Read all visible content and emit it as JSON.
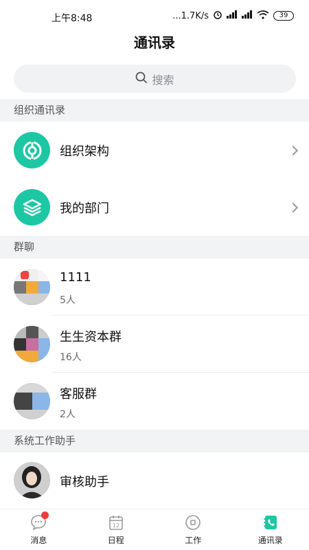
{
  "status_bar": {
    "time": "上午8:48",
    "network_speed": "...1.7K/s",
    "battery": "39"
  },
  "header": {
    "title": "通讯录"
  },
  "search": {
    "placeholder": "搜索"
  },
  "sections": {
    "org": {
      "header": "组织通讯录",
      "items": [
        {
          "label": "组织架构",
          "icon": "org-structure-icon"
        },
        {
          "label": "我的部门",
          "icon": "layers-icon"
        }
      ]
    },
    "groups": {
      "header": "群聊",
      "items": [
        {
          "name": "1111",
          "members": "5人"
        },
        {
          "name": "生生资本群",
          "members": "16人"
        },
        {
          "name": "客服群",
          "members": "2人"
        }
      ]
    },
    "assistants": {
      "header": "系统工作助手",
      "items": [
        {
          "name": "审核助手"
        }
      ]
    }
  },
  "tab_bar": {
    "tabs": [
      {
        "label": "消息",
        "icon": "message-icon",
        "badge": true
      },
      {
        "label": "日程",
        "icon": "calendar-icon",
        "calendar_day": "12"
      },
      {
        "label": "工作",
        "icon": "work-icon"
      },
      {
        "label": "通讯录",
        "icon": "contacts-icon",
        "active": true
      }
    ]
  },
  "colors": {
    "accent": "#1dc7a3",
    "badge": "#f03b3b",
    "section_bg": "#f2f3f5"
  }
}
